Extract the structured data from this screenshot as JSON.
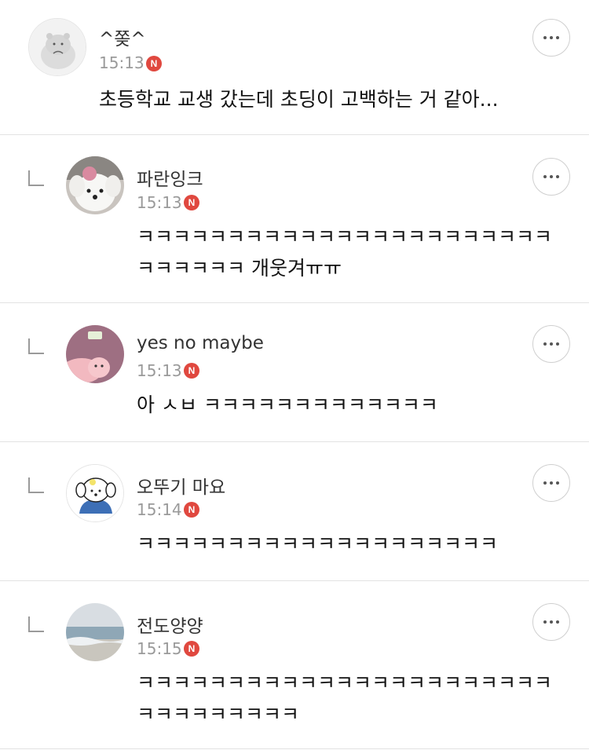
{
  "comments": [
    {
      "author": "^쫒^",
      "time": "15:13",
      "badge": "N",
      "text": [
        "초등학교 교생 갔는데 초딩이 고백하는 거 같아..."
      ],
      "avatar": "hippo-avatar"
    },
    {
      "author": "파란잉크",
      "time": "15:13",
      "badge": "N",
      "text": [
        "ㅋㅋㅋㅋㅋㅋㅋㅋㅋㅋㅋㅋㅋㅋㅋㅋㅋㅋㅋㅋㅋㅋㅋ",
        "ㅋㅋㅋㅋㅋㅋ 개웃겨ㅠㅠ"
      ],
      "avatar": "white-dog-avatar"
    },
    {
      "author": "yes no maybe",
      "time": "15:13",
      "badge": "N",
      "text": [
        "아 ㅅㅂ ㅋㅋㅋㅋㅋㅋㅋㅋㅋㅋㅋㅋㅋ"
      ],
      "avatar": "pig-avatar"
    },
    {
      "author": "오뚜기 마요",
      "time": "15:14",
      "badge": "N",
      "text": [
        "ㅋㅋㅋㅋㅋㅋㅋㅋㅋㅋㅋㅋㅋㅋㅋㅋㅋㅋㅋㅋ"
      ],
      "avatar": "cartoon-dog-avatar"
    },
    {
      "author": "전도양양",
      "time": "15:15",
      "badge": "N",
      "text": [
        "ㅋㅋㅋㅋㅋㅋㅋㅋㅋㅋㅋㅋㅋㅋㅋㅋㅋㅋㅋㅋㅋㅋㅋ",
        "ㅋㅋㅋㅋㅋㅋㅋㅋㅋ"
      ],
      "avatar": "sea-avatar"
    }
  ]
}
